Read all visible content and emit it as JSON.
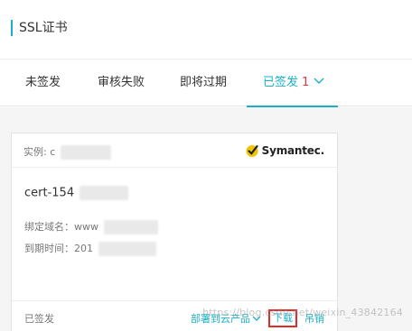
{
  "header": {
    "title": "SSL证书"
  },
  "tabs": [
    {
      "label": "未签发"
    },
    {
      "label": "审核失败"
    },
    {
      "label": "即将过期"
    },
    {
      "label": "已签发",
      "count": "1"
    }
  ],
  "card": {
    "instance_label": "实例: c",
    "brand": "Symantec.",
    "cert_name": "cert-154",
    "domain_label": "绑定域名：www",
    "expire_label": "到期时间：201",
    "status": "已签发",
    "actions": {
      "deploy": "部署到云产品",
      "download": "下载",
      "revoke": "吊销"
    }
  },
  "watermark": "https://blog.csdn.net/weixin_43842164",
  "colors": {
    "accent": "#1ab0c7",
    "count": "#e23a3a",
    "highlight_box": "#e12b2b"
  }
}
